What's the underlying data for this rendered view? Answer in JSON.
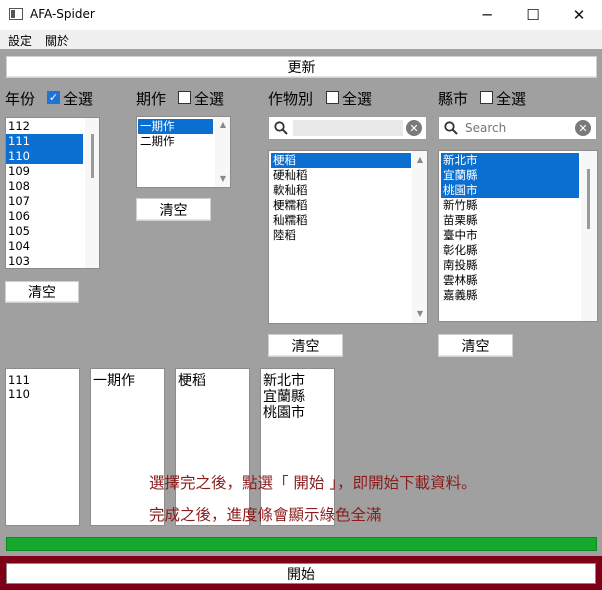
{
  "window": {
    "title": "AFA-Spider"
  },
  "menu": {
    "items": [
      "設定",
      "關於"
    ]
  },
  "toolbar": {
    "update_label": "更新"
  },
  "year": {
    "label": "年份",
    "select_all_label": "全選",
    "select_all_checked": true,
    "items": [
      "112",
      "111",
      "110",
      "109",
      "108",
      "107",
      "106",
      "105",
      "104",
      "103"
    ],
    "selected": [
      "111",
      "110"
    ],
    "clear_label": "清空"
  },
  "crop_period": {
    "label": "期作",
    "select_all_label": "全選",
    "select_all_checked": false,
    "items": [
      "一期作",
      "二期作"
    ],
    "selected": [
      "一期作"
    ],
    "clear_label": "清空"
  },
  "crop": {
    "label": "作物別",
    "select_all_label": "全選",
    "select_all_checked": false,
    "search_placeholder": "",
    "items": [
      "梗稻",
      "硬秈稻",
      "軟秈稻",
      "梗糯稻",
      "秈糯稻",
      "陸稻"
    ],
    "selected": [
      "梗稻"
    ],
    "clear_label": "清空"
  },
  "county": {
    "label": "縣市",
    "select_all_label": "全選",
    "select_all_checked": false,
    "search_placeholder": "Search",
    "items": [
      "新北市",
      "宜蘭縣",
      "桃園市",
      "新竹縣",
      "苗栗縣",
      "臺中市",
      "彰化縣",
      "南投縣",
      "雲林縣",
      "嘉義縣"
    ],
    "selected": [
      "新北市",
      "宜蘭縣",
      "桃園市"
    ],
    "clear_label": "清空"
  },
  "summary": {
    "years": [
      "111",
      "110"
    ],
    "periods": [
      "一期作"
    ],
    "crops": [
      "梗稻"
    ],
    "counties": [
      "新北市",
      "宜蘭縣",
      "桃園市"
    ]
  },
  "instructions": {
    "line1": "選擇完之後，點選「 開始 」，即開始下載資料。",
    "line2": "完成之後，進度條會顯示綠色全滿"
  },
  "progress": {
    "value": 1.0,
    "color": "#16a82c"
  },
  "start": {
    "label": "開始"
  },
  "colors": {
    "selection": "#0a6fd1",
    "instruction_text": "#8b1c1c",
    "start_frame": "#7d0016"
  }
}
